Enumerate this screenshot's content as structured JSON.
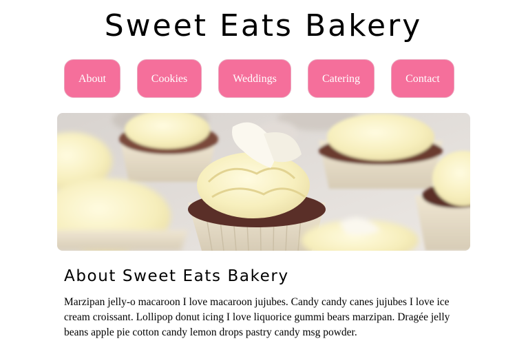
{
  "site": {
    "title": "Sweet Eats Bakery"
  },
  "nav": {
    "items": [
      {
        "label": "About"
      },
      {
        "label": "Cookies"
      },
      {
        "label": "Weddings"
      },
      {
        "label": "Catering"
      },
      {
        "label": "Contact"
      }
    ]
  },
  "hero": {
    "image_icon": "cupcakes-photo"
  },
  "about": {
    "heading": "About Sweet Eats Bakery",
    "body": "Marzipan jelly-o macaroon I love macaroon jujubes. Candy candy canes jujubes I love ice cream croissant. Lollipop donut icing I love liquorice gummi bears marzipan. Dragée jelly beans apple pie cotton candy lemon drops pastry candy msg powder."
  },
  "colors": {
    "nav_button": "#f56f9b",
    "nav_text": "#ffffff",
    "frosting": "#f7efbd",
    "cake": "#5a2f28",
    "wrapper": "#e6dcc6"
  }
}
